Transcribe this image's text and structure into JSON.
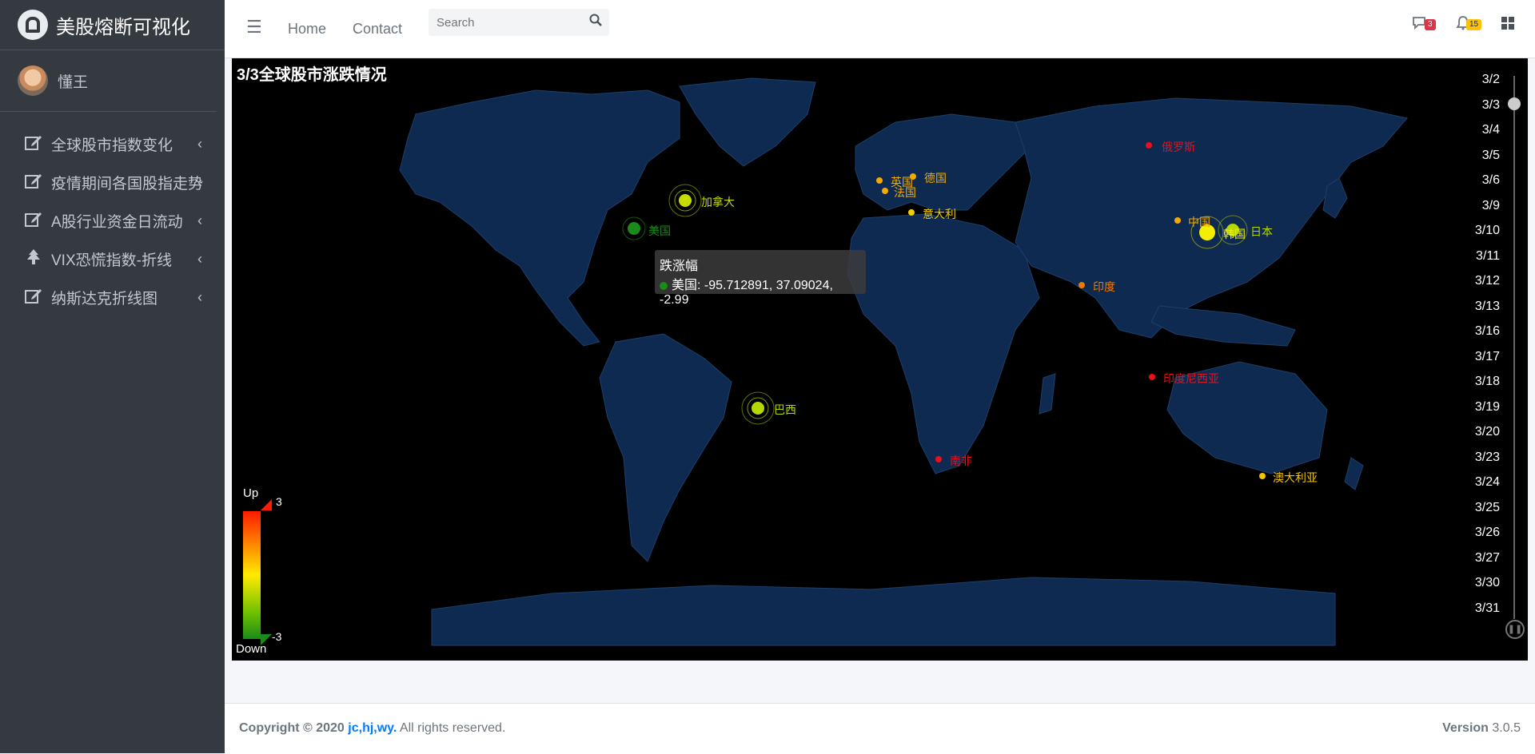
{
  "brand": {
    "title": "美股熔断可视化"
  },
  "user": {
    "name": "懂王"
  },
  "nav": {
    "items": [
      {
        "label": "全球股市指数变化",
        "icon": "edit-icon"
      },
      {
        "label": "疫情期间各国股指走势",
        "icon": "edit-icon"
      },
      {
        "label": "A股行业资金日流动",
        "icon": "edit-icon"
      },
      {
        "label": "VIX恐慌指数-折线",
        "icon": "tree-icon"
      },
      {
        "label": "纳斯达克折线图",
        "icon": "edit-icon"
      }
    ]
  },
  "topbar": {
    "home": "Home",
    "contact": "Contact",
    "search_placeholder": "Search",
    "messages_badge": "3",
    "notifications_badge": "15"
  },
  "map": {
    "title": "3/3全球股市涨跌情况",
    "tooltip_title": "跌涨幅",
    "tooltip_value": "美国: -95.712891, 37.09024, -2.99",
    "legend_up": "Up",
    "legend_down": "Down",
    "legend_max": "3",
    "legend_min": "-3",
    "timeline": [
      "3/2",
      "3/3",
      "3/4",
      "3/5",
      "3/6",
      "3/9",
      "3/10",
      "3/11",
      "3/12",
      "3/13",
      "3/16",
      "3/17",
      "3/18",
      "3/19",
      "3/20",
      "3/23",
      "3/24",
      "3/25",
      "3/26",
      "3/27",
      "3/30",
      "3/31"
    ],
    "countries": [
      {
        "name": "美国",
        "color": "#1a8a1a"
      },
      {
        "name": "加拿大",
        "color": "#c6dc00"
      },
      {
        "name": "巴西",
        "color": "#b6d800"
      },
      {
        "name": "英国",
        "color": "#f3a900"
      },
      {
        "name": "法国",
        "color": "#f3a900"
      },
      {
        "name": "德国",
        "color": "#f3a900"
      },
      {
        "name": "意大利",
        "color": "#f0d000"
      },
      {
        "name": "俄罗斯",
        "color": "#e8101a"
      },
      {
        "name": "中国",
        "color": "#f3a900"
      },
      {
        "name": "韩国",
        "color": "#f4ee00"
      },
      {
        "name": "日本",
        "color": "#b6d800"
      },
      {
        "name": "印度",
        "color": "#f07a00"
      },
      {
        "name": "印度尼西亚",
        "color": "#e8101a"
      },
      {
        "name": "南非",
        "color": "#e8101a"
      },
      {
        "name": "澳大利亚",
        "color": "#f3c400"
      }
    ]
  },
  "footer": {
    "copyright": "Copyright © 2020",
    "authors": "jc,hj,wy.",
    "rights": "All rights reserved.",
    "version_label": "Version",
    "version": "3.0.5"
  }
}
